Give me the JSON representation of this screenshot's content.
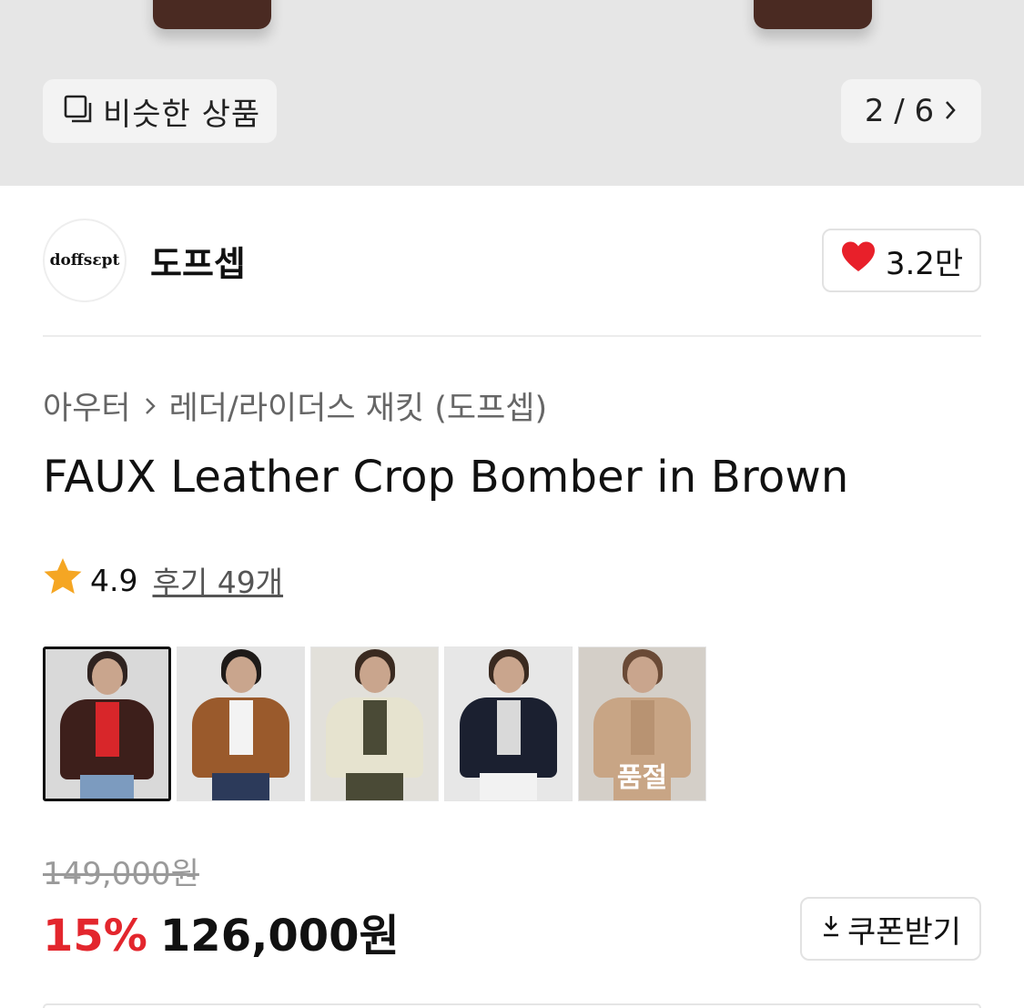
{
  "hero": {
    "similar_label": "비슷한 상품",
    "pager_text": "2 / 6"
  },
  "brand": {
    "logo_text": "doffsεpt",
    "name": "도프셉",
    "likes": "3.2만"
  },
  "breadcrumb": {
    "category": "아우터",
    "subcategory": "레더/라이더스 재킷 (도프셉)"
  },
  "product": {
    "title": "FAUX Leather Crop Bomber in Brown",
    "rating": "4.9",
    "reviews": "후기 49개"
  },
  "thumbnails": [
    {
      "name": "dark-brown-leather-jacket",
      "soldout": ""
    },
    {
      "name": "cognac-suede-jacket",
      "soldout": ""
    },
    {
      "name": "cream-jacket",
      "soldout": ""
    },
    {
      "name": "black-leather-jacket",
      "soldout": ""
    },
    {
      "name": "beige-jacket",
      "soldout": "품절"
    }
  ],
  "price": {
    "original": "149,000원",
    "discount": "15%",
    "current": "126,000원",
    "coupon_label": "쿠폰받기"
  },
  "colors": {
    "discount_red": "#e3262d",
    "heart_red": "#e8202a",
    "star": "#f5a623"
  }
}
